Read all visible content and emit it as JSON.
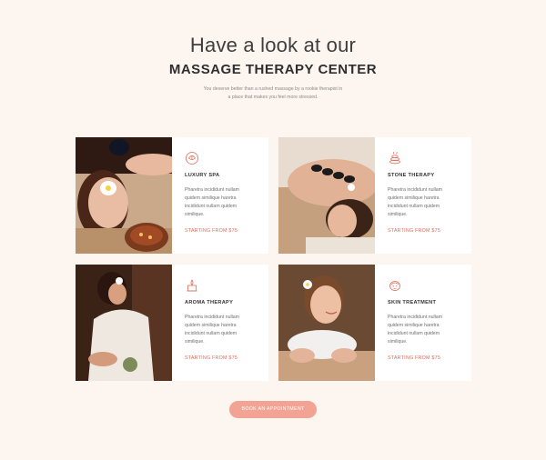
{
  "header": {
    "title_line1": "Have a look at our",
    "title_line2": "MASSAGE THERAPY CENTER",
    "intro_line1": "You deserve better than a rushed massage by a rookie therapist in",
    "intro_line2": "a place that makes you feel more stressed."
  },
  "services": [
    {
      "icon": "spa-lotus-icon",
      "title": "LUXURY SPA",
      "desc_lines": [
        "Pharetra incididunt nullam",
        "quidem similique haretra",
        "incididunt nullam quidem",
        "similique."
      ],
      "price": "STARTING FROM $75"
    },
    {
      "icon": "hot-stones-icon",
      "title": "STONE THERAPY",
      "desc_lines": [
        "Pharetra incididunt nullam",
        "quidem similique haretra",
        "incididunt nullam quidem",
        "similique."
      ],
      "price": "STARTING FROM $75"
    },
    {
      "icon": "aroma-candle-icon",
      "title": "AROMA THERAPY",
      "desc_lines": [
        "Pharetra incididunt nullam",
        "quidem similique haretra",
        "incididunt nullam quidem",
        "similique."
      ],
      "price": "STARTING FROM $75"
    },
    {
      "icon": "skin-face-icon",
      "title": "SKIN TREATMENT",
      "desc_lines": [
        "Pharetra incididunt nullam",
        "quidem similique haretra",
        "incididunt nullam quidem",
        "similique."
      ],
      "price": "STARTING FROM $75"
    }
  ],
  "cta": {
    "label": "BOOK AN APPOINTMENT"
  },
  "colors": {
    "background": "#fdf5ef",
    "accent": "#e06c5a",
    "button": "#f3a394"
  }
}
